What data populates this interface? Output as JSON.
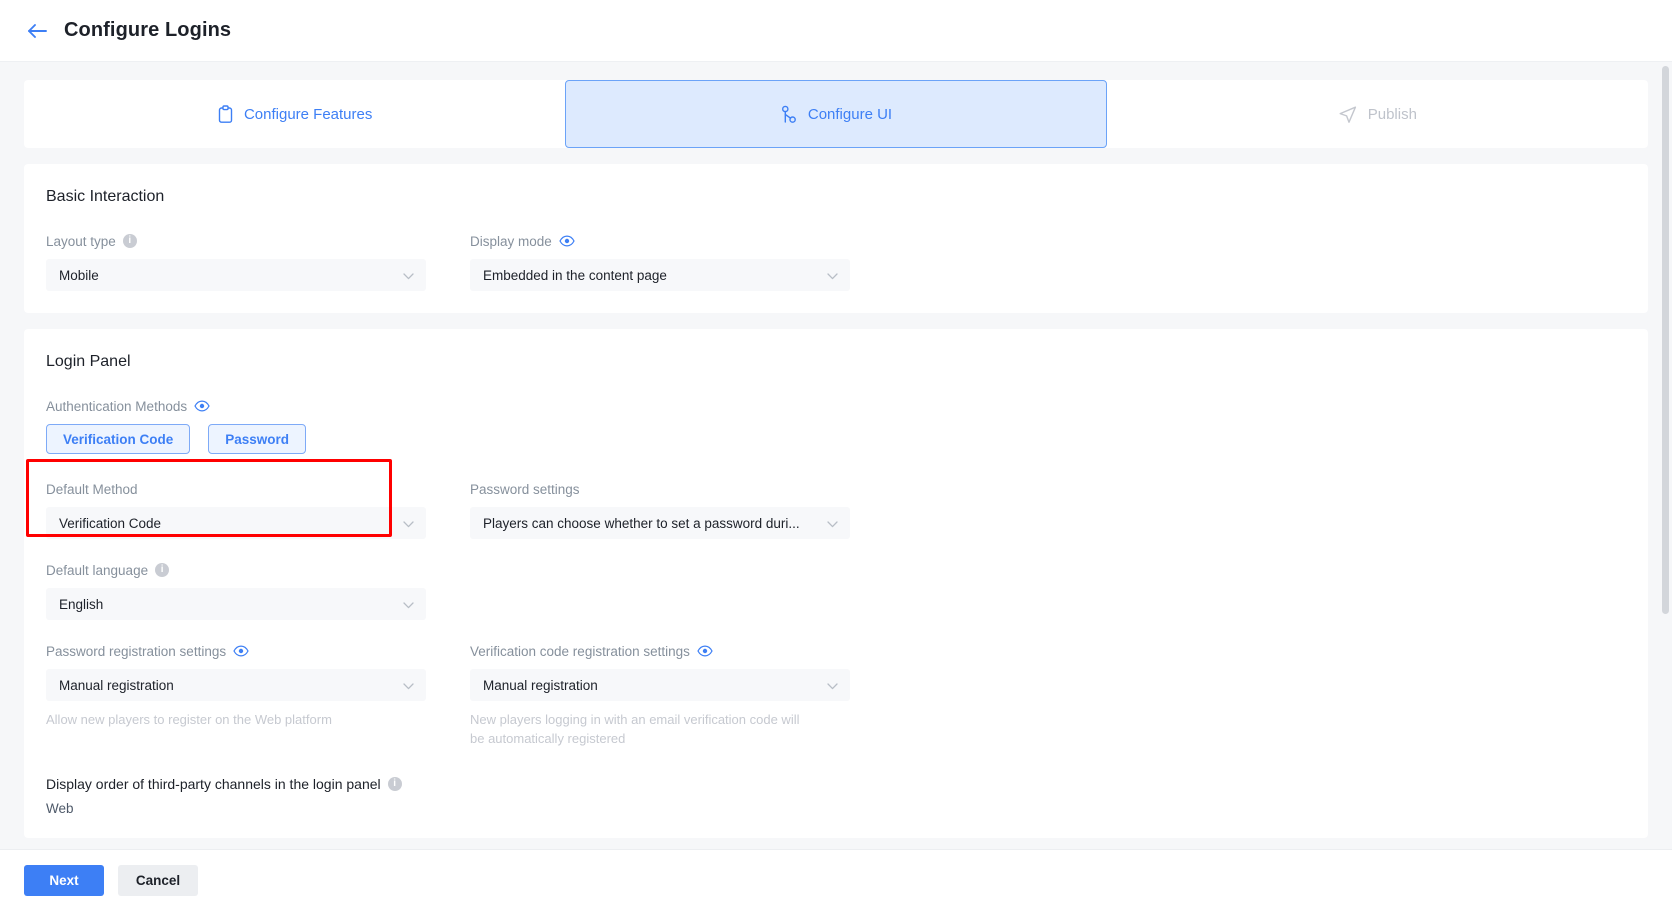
{
  "header": {
    "title": "Configure Logins",
    "back_icon": "arrow-left-icon"
  },
  "tabs": [
    {
      "label": "Configure Features",
      "icon": "clipboard-icon",
      "state": "available"
    },
    {
      "label": "Configure UI",
      "icon": "flow-node-icon",
      "state": "active"
    },
    {
      "label": "Publish",
      "icon": "paper-plane-icon",
      "state": "disabled"
    }
  ],
  "basic_interaction": {
    "title": "Basic Interaction",
    "layout_type": {
      "label": "Layout type",
      "icon": "info-icon",
      "value": "Mobile"
    },
    "display_mode": {
      "label": "Display mode",
      "icon": "eye-icon",
      "value": "Embedded in the content page"
    }
  },
  "login_panel": {
    "title": "Login Panel",
    "auth_methods": {
      "label": "Authentication Methods",
      "icon": "eye-icon",
      "chips": [
        "Verification Code",
        "Password"
      ]
    },
    "default_method": {
      "label": "Default Method",
      "value": "Verification Code"
    },
    "password_settings": {
      "label": "Password settings",
      "value": "Players can choose whether to set a password duri..."
    },
    "default_language": {
      "label": "Default language",
      "icon": "info-icon",
      "value": "English"
    },
    "password_registration": {
      "label": "Password registration settings",
      "icon": "eye-icon",
      "value": "Manual registration",
      "helper": "Allow new players to register on the Web platform"
    },
    "verification_code_registration": {
      "label": "Verification code registration settings",
      "icon": "eye-icon",
      "value": "Manual registration",
      "helper": "New players logging in with an email verification code will be automatically registered"
    },
    "third_party_order": {
      "label": "Display order of third-party channels in the login panel",
      "icon": "info-icon",
      "value": "Web"
    }
  },
  "footer": {
    "next_label": "Next",
    "cancel_label": "Cancel"
  },
  "colors": {
    "accent": "#3d7ff5",
    "active_tab_bg": "#ddeafe",
    "annotation": "#ff0000",
    "field_bg": "#f7f8fa",
    "page_bg": "#f6f7f9"
  }
}
